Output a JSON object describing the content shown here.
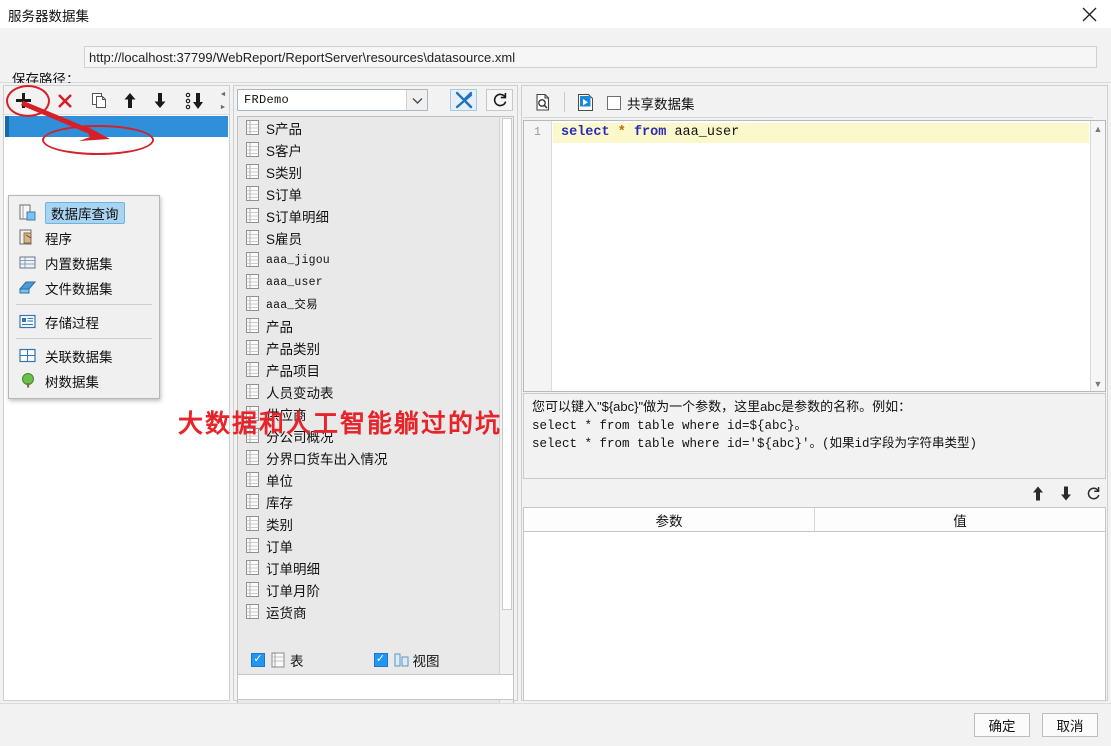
{
  "window": {
    "title": "服务器数据集",
    "close_icon": "close-icon"
  },
  "path_row": {
    "label": "保存路径：",
    "value": "http://localhost:37799/WebReport/ReportServer\\resources\\datasource.xml"
  },
  "left_toolbar": {
    "buttons": [
      {
        "name": "add-dataset-button",
        "icon": "plus-icon"
      },
      {
        "name": "delete-dataset-button",
        "icon": "cross-icon"
      },
      {
        "name": "copy-dataset-button",
        "icon": "copy-icon"
      },
      {
        "name": "move-up-button",
        "icon": "arrow-up-icon"
      },
      {
        "name": "move-down-button",
        "icon": "arrow-down-icon"
      },
      {
        "name": "sort-button",
        "icon": "sort-descending-icon"
      }
    ]
  },
  "popup_menu": {
    "items": [
      {
        "label": "数据库查询",
        "icon": "database-query-icon",
        "selected": true
      },
      {
        "label": "程序",
        "icon": "program-icon",
        "selected": false
      },
      {
        "label": "内置数据集",
        "icon": "embedded-dataset-icon",
        "selected": false
      },
      {
        "label": "文件数据集",
        "icon": "file-dataset-icon",
        "selected": false
      },
      {
        "separator": true
      },
      {
        "label": "存储过程",
        "icon": "stored-procedure-icon",
        "selected": false
      },
      {
        "separator": true
      },
      {
        "label": "关联数据集",
        "icon": "relation-dataset-icon",
        "selected": false
      },
      {
        "label": "树数据集",
        "icon": "tree-dataset-icon",
        "selected": false
      }
    ]
  },
  "datasource": {
    "selected": "FRDemo",
    "dropdown_icon": "chevron-down-icon",
    "config_icon": "wrench-icon",
    "refresh_icon": "refresh-icon"
  },
  "table_list": {
    "items": [
      {
        "label": "S产品",
        "mono": false
      },
      {
        "label": "S客户",
        "mono": false
      },
      {
        "label": "S类别",
        "mono": false
      },
      {
        "label": "S订单",
        "mono": false
      },
      {
        "label": "S订单明细",
        "mono": false
      },
      {
        "label": "S雇员",
        "mono": false
      },
      {
        "label": "aaa_jigou",
        "mono": true
      },
      {
        "label": "aaa_user",
        "mono": true
      },
      {
        "label": "aaa_交易",
        "mono": true
      },
      {
        "label": "产品",
        "mono": false
      },
      {
        "label": "产品类别",
        "mono": false
      },
      {
        "label": "产品项目",
        "mono": false
      },
      {
        "label": "人员变动表",
        "mono": false
      },
      {
        "label": "供应商",
        "mono": false
      },
      {
        "label": "分公司概况",
        "mono": false
      },
      {
        "label": "分界口货车出入情况",
        "mono": false
      },
      {
        "label": "单位",
        "mono": false
      },
      {
        "label": "库存",
        "mono": false
      },
      {
        "label": "类别",
        "mono": false
      },
      {
        "label": "订单",
        "mono": false
      },
      {
        "label": "订单明细",
        "mono": false
      },
      {
        "label": "订单月阶",
        "mono": false
      },
      {
        "label": "运货商",
        "mono": false
      }
    ],
    "row_icon": "table-icon"
  },
  "filters": {
    "table": {
      "label": "表",
      "checked": true,
      "icon": "table-icon"
    },
    "view": {
      "label": "视图",
      "checked": true,
      "icon": "view-icon"
    }
  },
  "sql_toolbar": {
    "preview_icon": "preview-icon",
    "run_icon": "run-sql-icon",
    "share_label": "共享数据集",
    "share_checked": false
  },
  "editor": {
    "line_number": "1",
    "code": {
      "keyword1": "select",
      "star": "*",
      "keyword2": "from",
      "identifier": "aaa_user"
    },
    "full_text": "select * from aaa_user"
  },
  "help": {
    "line1": "您可以键入\"${abc}\"做为一个参数，这里abc是参数的名称。例如：",
    "line2": "select * from table where id=${abc}。",
    "line3": "select * from table where id='${abc}'。(如果id字段为字符串类型)"
  },
  "param_tools": {
    "buttons": [
      {
        "name": "param-move-up-button",
        "glyph": "↑"
      },
      {
        "name": "param-move-down-button",
        "glyph": "↓"
      },
      {
        "name": "param-refresh-button",
        "glyph": "⟳"
      }
    ]
  },
  "param_table": {
    "columns": [
      "参数",
      "值"
    ],
    "rows": []
  },
  "footer": {
    "ok_label": "确定",
    "cancel_label": "取消"
  },
  "annotation": {
    "watermark": "大数据和人工智能躺过的坑",
    "highlight_color": "#d61f26"
  }
}
